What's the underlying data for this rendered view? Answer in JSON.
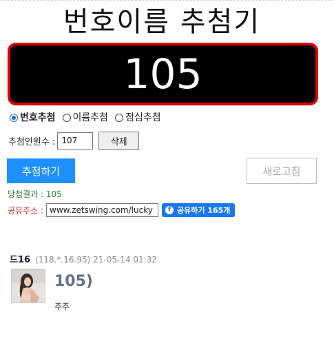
{
  "header": {
    "title": "번호이름 추첨기"
  },
  "display": {
    "number": "105"
  },
  "mode": {
    "options": [
      {
        "label": "번호추첨",
        "checked": true
      },
      {
        "label": "이름추첨",
        "checked": false
      },
      {
        "label": "점심추첨",
        "checked": false
      }
    ]
  },
  "count": {
    "label": "추첨인원수 :",
    "value": "107",
    "delete_label": "삭제"
  },
  "actions": {
    "draw_label": "추첨하기",
    "refresh_label": "새로고침"
  },
  "result": {
    "text": "당첨결과 : 105"
  },
  "share": {
    "label": "공유주소 :",
    "url": "www.zetswing.com/lucky",
    "fb_label": "공유하기 165개",
    "fb_icon": "f"
  },
  "comment": {
    "author": "드16",
    "meta": "(118.*.16.95) 21-05-14 01:32",
    "body_big": "105)",
    "body_small": "추추"
  },
  "colors": {
    "display_border": "#e00000",
    "primary": "#1e90ff",
    "result_text": "#2e7d32",
    "share_label": "#d32f2f",
    "facebook": "#1877f2"
  }
}
